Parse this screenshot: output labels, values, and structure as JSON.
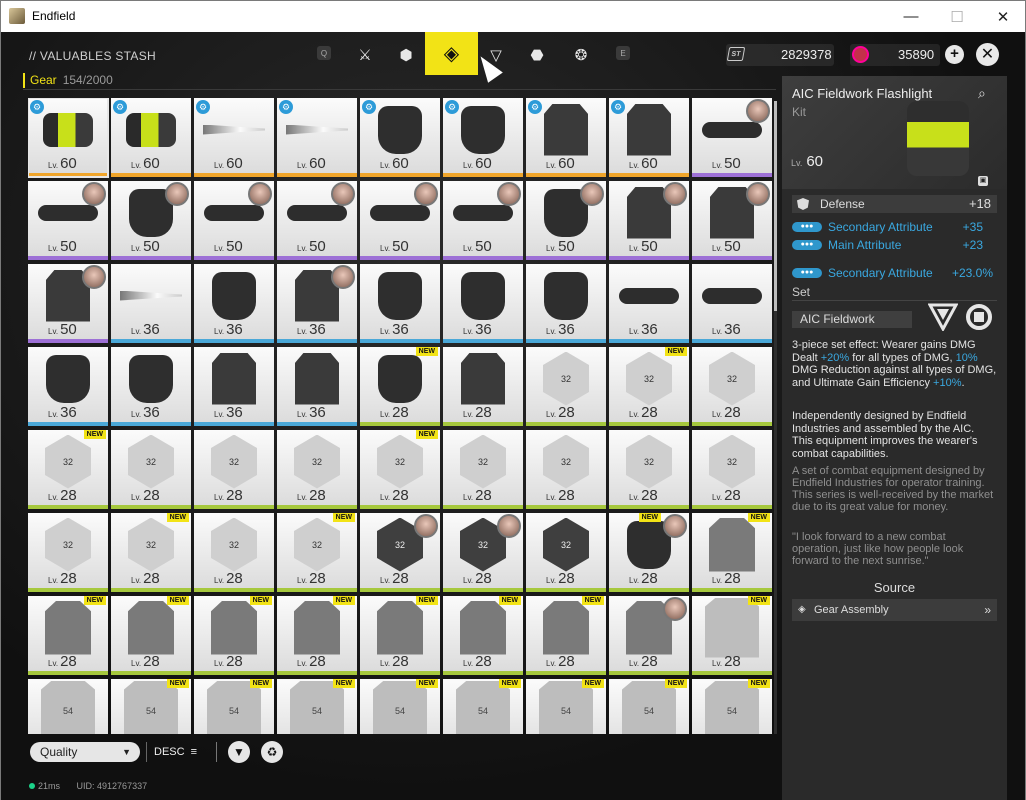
{
  "window": {
    "title": "Endfield",
    "min": "—",
    "max": "☐",
    "close": "✕"
  },
  "header": {
    "title": "// VALUABLES STASH",
    "key_left": "Q",
    "key_right": "E",
    "tabs": [
      {
        "name": "tab-weapon",
        "glyph": "⚔"
      },
      {
        "name": "tab-cube",
        "glyph": "⬢"
      },
      {
        "name": "tab-gear",
        "glyph": "◈",
        "active": true
      },
      {
        "name": "tab-triangle",
        "glyph": "▽"
      },
      {
        "name": "tab-shield",
        "glyph": "⬣"
      },
      {
        "name": "tab-circle",
        "glyph": "❂"
      }
    ],
    "currency1_icon": "ST",
    "currency1_value": "2829378",
    "currency2_value": "35890",
    "plus": "+",
    "close": "✕"
  },
  "category": {
    "name": "Gear",
    "count": "154/2000"
  },
  "level_prefix": "Lv.",
  "new_label": "NEW",
  "gear_items": [
    {
      "lv": "60",
      "q": "gold",
      "art": "flash",
      "badge": true,
      "sel": true
    },
    {
      "lv": "60",
      "q": "gold",
      "art": "flash",
      "badge": true
    },
    {
      "lv": "60",
      "q": "gold",
      "art": "blade",
      "badge": true
    },
    {
      "lv": "60",
      "q": "gold",
      "art": "blade",
      "badge": true
    },
    {
      "lv": "60",
      "q": "gold",
      "art": "glove",
      "badge": true
    },
    {
      "lv": "60",
      "q": "gold",
      "art": "glove",
      "badge": true
    },
    {
      "lv": "60",
      "q": "gold",
      "art": "vest",
      "badge": true
    },
    {
      "lv": "60",
      "q": "gold",
      "art": "vest",
      "badge": true
    },
    {
      "lv": "50",
      "q": "purple",
      "art": "tube",
      "avatar": true
    },
    {
      "lv": "50",
      "q": "purple",
      "art": "tube",
      "avatar": true
    },
    {
      "lv": "50",
      "q": "purple",
      "art": "glove",
      "avatar": true
    },
    {
      "lv": "50",
      "q": "purple",
      "art": "tube",
      "avatar": true
    },
    {
      "lv": "50",
      "q": "purple",
      "art": "tube",
      "avatar": true
    },
    {
      "lv": "50",
      "q": "purple",
      "art": "tube",
      "avatar": true
    },
    {
      "lv": "50",
      "q": "purple",
      "art": "tube",
      "avatar": true
    },
    {
      "lv": "50",
      "q": "purple",
      "art": "glove",
      "avatar": true
    },
    {
      "lv": "50",
      "q": "purple",
      "art": "vest",
      "avatar": true
    },
    {
      "lv": "50",
      "q": "purple",
      "art": "vest",
      "avatar": true
    },
    {
      "lv": "50",
      "q": "purple",
      "art": "vest",
      "avatar": true
    },
    {
      "lv": "36",
      "q": "blue",
      "art": "blade"
    },
    {
      "lv": "36",
      "q": "blue",
      "art": "glove"
    },
    {
      "lv": "36",
      "q": "blue",
      "art": "vest",
      "avatar": true
    },
    {
      "lv": "36",
      "q": "blue",
      "art": "glove"
    },
    {
      "lv": "36",
      "q": "blue",
      "art": "glove"
    },
    {
      "lv": "36",
      "q": "blue",
      "art": "glove"
    },
    {
      "lv": "36",
      "q": "blue",
      "art": "tube"
    },
    {
      "lv": "36",
      "q": "blue",
      "art": "tube"
    },
    {
      "lv": "36",
      "q": "blue",
      "art": "glove"
    },
    {
      "lv": "36",
      "q": "blue",
      "art": "glove"
    },
    {
      "lv": "36",
      "q": "blue",
      "art": "vest"
    },
    {
      "lv": "36",
      "q": "blue",
      "art": "vest"
    },
    {
      "lv": "28",
      "q": "green",
      "art": "glove",
      "newtag": true
    },
    {
      "lv": "28",
      "q": "green",
      "art": "vest"
    },
    {
      "lv": "28",
      "q": "green",
      "art": "hex",
      "label": "32"
    },
    {
      "lv": "28",
      "q": "green",
      "art": "hex",
      "label": "32",
      "newtag": true
    },
    {
      "lv": "28",
      "q": "green",
      "art": "hex",
      "label": "32"
    },
    {
      "lv": "28",
      "q": "green",
      "art": "hex",
      "label": "32",
      "newtag": true
    },
    {
      "lv": "28",
      "q": "green",
      "art": "hex",
      "label": "32"
    },
    {
      "lv": "28",
      "q": "green",
      "art": "hex",
      "label": "32"
    },
    {
      "lv": "28",
      "q": "green",
      "art": "hex",
      "label": "32"
    },
    {
      "lv": "28",
      "q": "green",
      "art": "hex",
      "label": "32",
      "newtag": true
    },
    {
      "lv": "28",
      "q": "green",
      "art": "hex",
      "label": "32"
    },
    {
      "lv": "28",
      "q": "green",
      "art": "hex",
      "label": "32"
    },
    {
      "lv": "28",
      "q": "green",
      "art": "hex",
      "label": "32"
    },
    {
      "lv": "28",
      "q": "green",
      "art": "hex",
      "label": "32"
    },
    {
      "lv": "28",
      "q": "green",
      "art": "hex",
      "label": "32"
    },
    {
      "lv": "28",
      "q": "green",
      "art": "hex",
      "label": "32",
      "newtag": true
    },
    {
      "lv": "28",
      "q": "green",
      "art": "hex",
      "label": "32"
    },
    {
      "lv": "28",
      "q": "green",
      "art": "hex",
      "label": "32",
      "newtag": true
    },
    {
      "lv": "28",
      "q": "green",
      "art": "hexdark",
      "label": "32",
      "avatar": true
    },
    {
      "lv": "28",
      "q": "green",
      "art": "hexdark",
      "label": "32",
      "avatar": true
    },
    {
      "lv": "28",
      "q": "green",
      "art": "hexdark",
      "label": "32"
    },
    {
      "lv": "28",
      "q": "green",
      "art": "glove",
      "avatar": true,
      "newtag": true
    },
    {
      "lv": "28",
      "q": "green",
      "art": "armor",
      "newtag": true
    },
    {
      "lv": "28",
      "q": "green",
      "art": "armor",
      "newtag": true
    },
    {
      "lv": "28",
      "q": "green",
      "art": "armor",
      "newtag": true
    },
    {
      "lv": "28",
      "q": "green",
      "art": "armor",
      "newtag": true
    },
    {
      "lv": "28",
      "q": "green",
      "art": "armor",
      "newtag": true
    },
    {
      "lv": "28",
      "q": "green",
      "art": "armor",
      "newtag": true
    },
    {
      "lv": "28",
      "q": "green",
      "art": "armor",
      "newtag": true
    },
    {
      "lv": "28",
      "q": "green",
      "art": "armor",
      "newtag": true
    },
    {
      "lv": "28",
      "q": "green",
      "art": "armor",
      "avatar": true
    },
    {
      "lv": "28",
      "q": "green",
      "art": "plate",
      "newtag": true
    },
    {
      "lv": "",
      "q": "",
      "art": "plate",
      "label": "54"
    },
    {
      "lv": "",
      "q": "",
      "art": "plate",
      "label": "54",
      "newtag": true
    },
    {
      "lv": "",
      "q": "",
      "art": "plate",
      "label": "54",
      "newtag": true
    },
    {
      "lv": "",
      "q": "",
      "art": "plate",
      "label": "54",
      "newtag": true
    },
    {
      "lv": "",
      "q": "",
      "art": "plate",
      "label": "54",
      "newtag": true
    },
    {
      "lv": "",
      "q": "",
      "art": "plate",
      "label": "54",
      "newtag": true
    },
    {
      "lv": "",
      "q": "",
      "art": "plate",
      "label": "54",
      "newtag": true
    },
    {
      "lv": "",
      "q": "",
      "art": "plate",
      "label": "54",
      "newtag": true
    },
    {
      "lv": "",
      "q": "",
      "art": "plate",
      "label": "54",
      "newtag": true
    }
  ],
  "detail": {
    "name": "AIC Fieldwork Flashlight",
    "type": "Kit",
    "level_prefix": "Lv.",
    "level": "60",
    "main_stat": {
      "label": "Defense",
      "value": "+18"
    },
    "stats": [
      {
        "label": "Secondary Attribute",
        "value": "+35"
      },
      {
        "label": "Main Attribute",
        "value": "+23"
      }
    ],
    "extra_stat": {
      "label": "Secondary Attribute",
      "value": "+23.0%"
    },
    "set_label": "Set",
    "set_name": "AIC Fieldwork",
    "set_effect_a": "3-piece set effect: Wearer gains DMG Dealt ",
    "set_effect_b": "+20%",
    "set_effect_c": " for all types of DMG, ",
    "set_effect_d": "10%",
    "set_effect_e": " DMG Reduction against all types of DMG, and Ultimate Gain Efficiency ",
    "set_effect_f": "+10%",
    "set_effect_g": ".",
    "desc": "Independently designed by Endfield Industries and assembled by the AIC. This equipment improves the wearer's combat capabilities.",
    "lore": "A set of combat equipment designed by Endfield Industries for operator training. This series is well-received by the market due to its great value for money.",
    "quote": "\"I look forward to a new combat operation, just like how people look forward to the next sunrise.\"",
    "source_title": "Source",
    "source_item": "Gear Assembly"
  },
  "bottom": {
    "sort": "Quality",
    "order": "DESC",
    "order_icon": "≡",
    "filter_icon": "▼",
    "recycle_icon": "♻"
  },
  "status": {
    "ping": "21ms",
    "uid": "UID: 4912767337"
  }
}
